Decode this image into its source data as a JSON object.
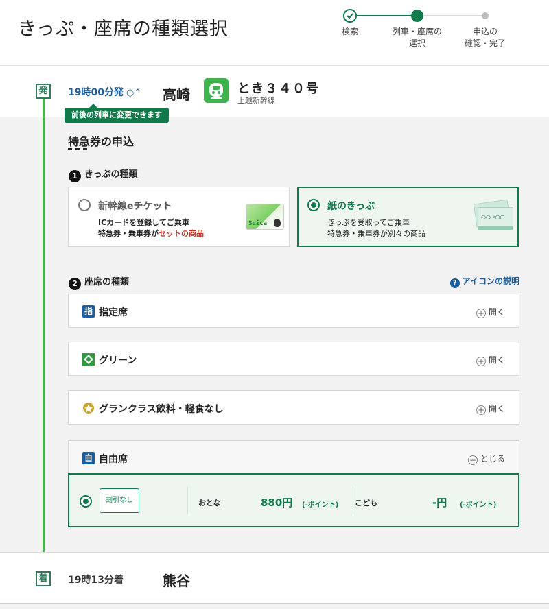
{
  "header": {
    "title": "きっぷ・座席の種類選択",
    "steps": [
      {
        "label": "検索"
      },
      {
        "label_line1": "列車・座席の",
        "label_line2": "選択"
      },
      {
        "label_line1": "申込の",
        "label_line2": "確認・完了"
      }
    ]
  },
  "departure": {
    "tag": "発",
    "time": "19時00分発",
    "tooltip": "前後の列車に変更できます",
    "station": "高崎",
    "train_name": "とき３４０号",
    "line": "上越新幹線"
  },
  "section": {
    "title": "特急券の申込"
  },
  "ticket_type": {
    "number": "1",
    "heading": "きっぷの種類",
    "options": [
      {
        "title": "新幹線eチケット",
        "line1": "ICカードを登録してご乗車",
        "line2_prefix": "特急券・乗車券が",
        "line2_highlight": "セットの商品",
        "image_text": "Suica",
        "selected": false
      },
      {
        "title": "紙のきっぷ",
        "line1": "きっぷを受取ってご乗車",
        "line2": "特急券・乗車券が別々の商品",
        "image_text": "○○→○○",
        "selected": true
      }
    ]
  },
  "seat_type": {
    "number": "2",
    "heading": "座席の種類",
    "help": "アイコンの説明",
    "rows": [
      {
        "icon_text": "指",
        "label": "指定席",
        "toggle": "開く"
      },
      {
        "label": "グリーン",
        "toggle": "開く"
      },
      {
        "label": "グランクラス飲料・軽食なし",
        "toggle": "開く"
      },
      {
        "icon_text": "自",
        "label": "自由席",
        "toggle": "とじる"
      }
    ],
    "fare": {
      "discount": "割引なし",
      "adult_label": "おとな",
      "adult_price": "880円",
      "adult_points": "(-ポイント)",
      "child_label": "こども",
      "child_price": "-円",
      "child_points": "(-ポイント)"
    }
  },
  "arrival": {
    "tag": "着",
    "time": "19時13分着",
    "station": "熊谷"
  },
  "colors": {
    "accent": "#117a4b",
    "timeline": "#4caf50",
    "link": "#1b5e9e",
    "highlight_red": "#c0392b"
  }
}
